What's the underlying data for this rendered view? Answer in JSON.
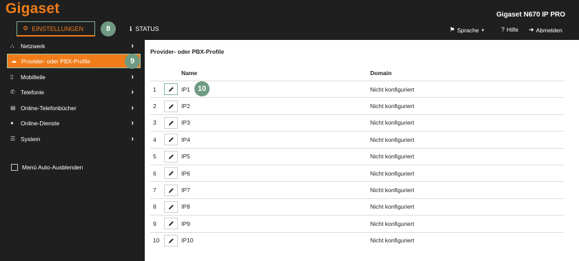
{
  "header": {
    "logo": "Gigaset",
    "product": "Gigaset N670 IP PRO",
    "tabs": [
      {
        "label": "EINSTELLUNGEN",
        "icon": "gears-icon"
      },
      {
        "label": "STATUS",
        "icon": "info-icon"
      }
    ],
    "language": "Sprache",
    "help": "Hilfe",
    "logout": "Abmelden"
  },
  "badges": [
    "8",
    "9",
    "10"
  ],
  "sidebar": {
    "items": [
      {
        "label": "Netzwerk",
        "icon": "network-icon"
      },
      {
        "label": "Provider- oder PBX-Profile",
        "icon": "cloud-icon",
        "active": true
      },
      {
        "label": "Mobilteile",
        "icon": "handset-icon"
      },
      {
        "label": "Telefonie",
        "icon": "phone-icon"
      },
      {
        "label": "Online-Telefonbücher",
        "icon": "book-icon"
      },
      {
        "label": "Online-Dienste",
        "icon": "globe-icon"
      },
      {
        "label": "System",
        "icon": "sliders-icon"
      }
    ],
    "autohide": "Menü Auto-Ausblenden"
  },
  "main": {
    "title": "Provider- oder PBX-Profile",
    "columns": [
      "Name",
      "Domain"
    ],
    "rows": [
      {
        "num": "1",
        "name": "IP1",
        "domain": "Nicht konfiguriert"
      },
      {
        "num": "2",
        "name": "IP2",
        "domain": "Nicht konfiguriert"
      },
      {
        "num": "3",
        "name": "IP3",
        "domain": "Nicht konfiguriert"
      },
      {
        "num": "4",
        "name": "IP4",
        "domain": "Nicht konfiguriert"
      },
      {
        "num": "5",
        "name": "IP5",
        "domain": "Nicht konfiguriert"
      },
      {
        "num": "6",
        "name": "IP6",
        "domain": "Nicht konfiguriert"
      },
      {
        "num": "7",
        "name": "IP7",
        "domain": "Nicht konfiguriert"
      },
      {
        "num": "8",
        "name": "IP8",
        "domain": "Nicht konfiguriert"
      },
      {
        "num": "9",
        "name": "IP9",
        "domain": "Nicht konfiguriert"
      },
      {
        "num": "10",
        "name": "IP10",
        "domain": "Nicht konfiguriert"
      }
    ]
  },
  "colors": {
    "accent": "#f07d19",
    "badge": "#6e9a82",
    "highlight": "#7fb59a",
    "dark": "#1f1f1f"
  }
}
